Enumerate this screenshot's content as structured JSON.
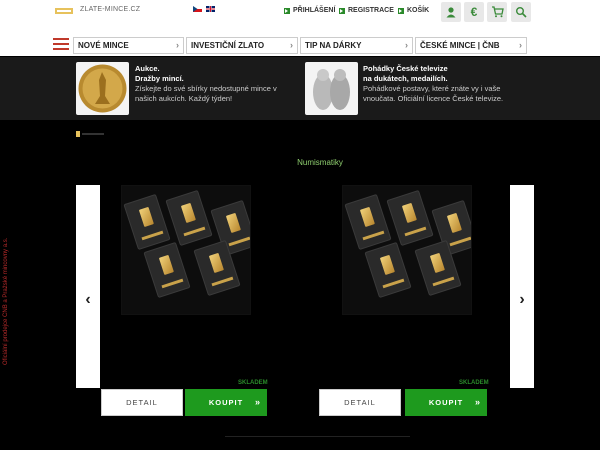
{
  "header": {
    "site_name": "ZLATE-MINCE.CZ",
    "links": [
      "PŘIHLÁŠENÍ",
      "REGISTRACE",
      "KOŠÍK"
    ],
    "icons": [
      "user-icon",
      "euro-icon",
      "cart-icon",
      "search-icon"
    ]
  },
  "nav": {
    "items": [
      "NOVÉ MINCE",
      "INVESTIČNÍ ZLATO",
      "TIP NA DÁRKY",
      "ČESKÉ MINCE | ČNB"
    ]
  },
  "promo": {
    "left": {
      "title1": "Aukce.",
      "title2": "Dražby mincí.",
      "text": "Získejte do své sbírky nedostupné mince v našich aukcích. Každý týden!"
    },
    "right": {
      "title1": "Pohádky České televize",
      "title2": "na dukátech, medailích.",
      "text": "Pohádkové postavy, které znáte vy i vaše vnoučata. Oficiální licence České televize."
    }
  },
  "main": {
    "section_title": "Numismatiky",
    "side_text": "Oficiální prodejce ČNB a Pražské mincovny a.s."
  },
  "products": [
    {
      "stock": "SKLADEM",
      "detail": "DETAIL",
      "buy": "KOUPIT"
    },
    {
      "stock": "SKLADEM",
      "detail": "DETAIL",
      "buy": "KOUPIT"
    }
  ],
  "colors": {
    "accent_green": "#1e9a1e",
    "brand_red": "#c0392b"
  }
}
